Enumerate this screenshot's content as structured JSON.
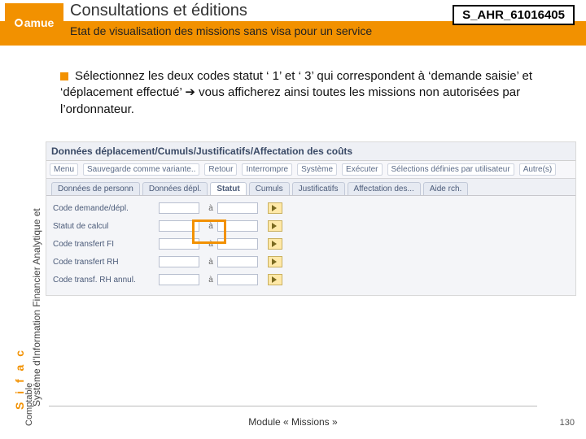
{
  "header": {
    "logo_text": "amue",
    "title": "Consultations et éditions",
    "subtitle": "Etat de visualisation des missions sans visa pour un service",
    "code": "S_AHR_61016405"
  },
  "sidebar": {
    "brand": "S i f a c",
    "line1": "Système d'Information Financier Analytique et",
    "line2": "Comptable"
  },
  "body": {
    "paragraph": "Sélectionnez les deux codes statut ‘ 1’ et ‘ 3’ qui correspondent à ‘demande saisie’ et ‘déplacement effectué’ ➔ vous afficherez ainsi toutes les missions non autorisées par l’ordonnateur."
  },
  "sap": {
    "window_title": "Données déplacement/Cumuls/Justificatifs/Affectation des coûts",
    "menu": [
      "Menu",
      "Sauvegarde comme variante..",
      "Retour",
      "Interrompre",
      "Système",
      "Exécuter",
      "Sélections définies par utilisateur",
      "Autre(s)"
    ],
    "tabs": [
      "Données de personn",
      "Données dépl.",
      "Statut",
      "Cumuls",
      "Justificatifs",
      "Affectation des...",
      "Aide rch."
    ],
    "active_tab": 2,
    "rows": [
      {
        "label": "Code demande/dépl.",
        "to": "à"
      },
      {
        "label": "Statut de calcul",
        "to": "à"
      },
      {
        "label": "Code transfert FI",
        "to": "à"
      },
      {
        "label": "Code transfert RH",
        "to": "à"
      },
      {
        "label": "Code transf. RH annul.",
        "to": "à"
      }
    ]
  },
  "footer": {
    "module": "Module « Missions »",
    "page": "130"
  }
}
